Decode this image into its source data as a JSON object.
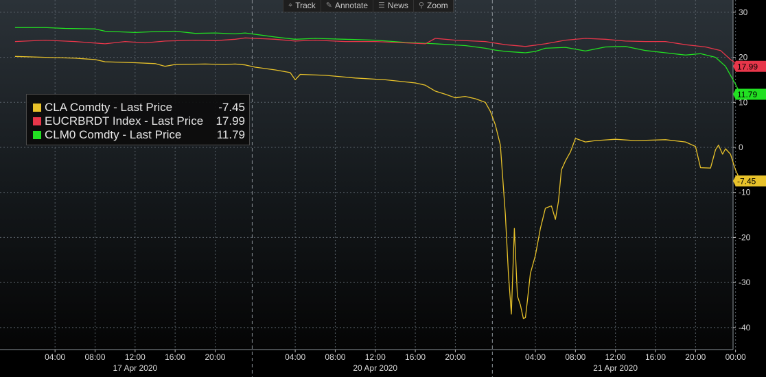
{
  "toolbar": {
    "items": [
      {
        "label": "Track",
        "icon": "crosshair-icon"
      },
      {
        "label": "Annotate",
        "icon": "pencil-icon"
      },
      {
        "label": "News",
        "icon": "news-icon"
      },
      {
        "label": "Zoom",
        "icon": "magnifier-icon"
      }
    ]
  },
  "legend": [
    {
      "name": "CLA Comdty - Last Price",
      "value": "-7.45",
      "color": "#e8c22a"
    },
    {
      "name": "EUCRBRDT Index - Last Price",
      "value": "17.99",
      "color": "#e8364a"
    },
    {
      "name": "CLM0 Comdty - Last Price",
      "value": "11.79",
      "color": "#22e022"
    }
  ],
  "chart_data": {
    "type": "line",
    "title": "",
    "xlabel": "",
    "ylabel": "",
    "x_unit": "hours from 17 Apr 2020 00:00 (compressed session axis)",
    "ylim": [
      -45,
      32
    ],
    "y_ticks": [
      -40,
      -30,
      -20,
      -10,
      0,
      10,
      20,
      30
    ],
    "grid": true,
    "legend_position": "top-left",
    "day_labels": [
      {
        "label": "17 Apr 2020"
      },
      {
        "label": "20 Apr 2020"
      },
      {
        "label": "21 Apr 2020"
      }
    ],
    "x_ticks": [
      {
        "label": "04:00",
        "day": 0,
        "hour": 4
      },
      {
        "label": "08:00",
        "day": 0,
        "hour": 8
      },
      {
        "label": "12:00",
        "day": 0,
        "hour": 12
      },
      {
        "label": "16:00",
        "day": 0,
        "hour": 16
      },
      {
        "label": "20:00",
        "day": 0,
        "hour": 20
      },
      {
        "label": "04:00",
        "day": 1,
        "hour": 4
      },
      {
        "label": "08:00",
        "day": 1,
        "hour": 8
      },
      {
        "label": "12:00",
        "day": 1,
        "hour": 12
      },
      {
        "label": "16:00",
        "day": 1,
        "hour": 16
      },
      {
        "label": "20:00",
        "day": 1,
        "hour": 20
      },
      {
        "label": "04:00",
        "day": 2,
        "hour": 4
      },
      {
        "label": "08:00",
        "day": 2,
        "hour": 8
      },
      {
        "label": "12:00",
        "day": 2,
        "hour": 12
      },
      {
        "label": "16:00",
        "day": 2,
        "hour": 16
      },
      {
        "label": "20:00",
        "day": 2,
        "hour": 20
      },
      {
        "label": "00:00",
        "day": 3,
        "hour": 0
      }
    ],
    "last_values": [
      {
        "label": "17.99",
        "value": 17.99,
        "color": "#e8364a"
      },
      {
        "label": "11.79",
        "value": 11.79,
        "color": "#22e022"
      },
      {
        "label": "-7.45",
        "value": -7.45,
        "color": "#e8c22a"
      }
    ],
    "series": [
      {
        "name": "CLA Comdty - Last Price",
        "color": "#e8c22a",
        "points": [
          [
            0,
            20.2
          ],
          [
            3,
            20.0
          ],
          [
            6,
            19.8
          ],
          [
            8,
            19.5
          ],
          [
            9,
            19.0
          ],
          [
            12,
            18.8
          ],
          [
            14,
            18.6
          ],
          [
            15,
            18.0
          ],
          [
            16,
            18.4
          ],
          [
            19,
            18.5
          ],
          [
            21,
            18.4
          ],
          [
            22,
            18.5
          ],
          [
            23,
            18.3
          ],
          [
            24,
            17.8
          ],
          [
            26,
            17.2
          ],
          [
            27.5,
            16.6
          ],
          [
            28,
            15.0
          ],
          [
            28.5,
            16.2
          ],
          [
            31,
            16.0
          ],
          [
            34,
            15.4
          ],
          [
            37,
            15.0
          ],
          [
            40,
            14.3
          ],
          [
            41,
            13.8
          ],
          [
            42,
            12.5
          ],
          [
            43,
            11.8
          ],
          [
            44,
            11.0
          ],
          [
            45,
            11.3
          ],
          [
            46,
            10.8
          ],
          [
            47,
            10.0
          ],
          [
            47.5,
            8.0
          ],
          [
            48,
            5.0
          ],
          [
            48.5,
            0.5
          ],
          [
            49,
            -15
          ],
          [
            49.3,
            -28
          ],
          [
            49.6,
            -37
          ],
          [
            49.9,
            -18
          ],
          [
            50.2,
            -33
          ],
          [
            50.5,
            -35
          ],
          [
            50.8,
            -38
          ],
          [
            51,
            -37.8
          ],
          [
            51.2,
            -34
          ],
          [
            51.5,
            -28
          ],
          [
            52,
            -24
          ],
          [
            52.5,
            -18
          ],
          [
            53,
            -13.5
          ],
          [
            53.6,
            -13
          ],
          [
            54,
            -16
          ],
          [
            54.3,
            -12
          ],
          [
            54.6,
            -5
          ],
          [
            55,
            -3
          ],
          [
            55.5,
            -1
          ],
          [
            56,
            2.0
          ],
          [
            57,
            1.2
          ],
          [
            58,
            1.5
          ],
          [
            60,
            1.8
          ],
          [
            62,
            1.5
          ],
          [
            65,
            1.7
          ],
          [
            67,
            1.2
          ],
          [
            68,
            0.2
          ],
          [
            68.5,
            -4.5
          ],
          [
            69.5,
            -4.6
          ],
          [
            70,
            -0.5
          ],
          [
            70.3,
            0.5
          ],
          [
            70.7,
            -1.5
          ],
          [
            71,
            -0.3
          ],
          [
            71.5,
            -1.5
          ],
          [
            72,
            -5.0
          ],
          [
            72.5,
            -7.45
          ]
        ]
      },
      {
        "name": "EUCRBRDT Index - Last Price",
        "color": "#e8364a",
        "points": [
          [
            0,
            23.5
          ],
          [
            3,
            23.8
          ],
          [
            6,
            23.5
          ],
          [
            9,
            23.0
          ],
          [
            11,
            23.5
          ],
          [
            13,
            23.2
          ],
          [
            15,
            23.6
          ],
          [
            18,
            23.8
          ],
          [
            20,
            23.7
          ],
          [
            22,
            24.0
          ],
          [
            23,
            24.3
          ],
          [
            26,
            24.0
          ],
          [
            28,
            23.6
          ],
          [
            30,
            23.8
          ],
          [
            33,
            23.5
          ],
          [
            36,
            23.5
          ],
          [
            39,
            23.2
          ],
          [
            41,
            23.0
          ],
          [
            42,
            24.2
          ],
          [
            44,
            23.8
          ],
          [
            47,
            23.5
          ],
          [
            49,
            22.8
          ],
          [
            51,
            22.4
          ],
          [
            53,
            23.0
          ],
          [
            55,
            23.8
          ],
          [
            57,
            24.2
          ],
          [
            59,
            24.0
          ],
          [
            61,
            23.6
          ],
          [
            63,
            23.5
          ],
          [
            65,
            23.5
          ],
          [
            67,
            22.8
          ],
          [
            69,
            22.3
          ],
          [
            70.5,
            21.5
          ],
          [
            71.5,
            19.5
          ],
          [
            72.5,
            17.99
          ]
        ]
      },
      {
        "name": "CLM0 Comdty - Last Price",
        "color": "#22e022",
        "points": [
          [
            0,
            26.6
          ],
          [
            3,
            26.6
          ],
          [
            5,
            26.4
          ],
          [
            8,
            26.3
          ],
          [
            9,
            25.8
          ],
          [
            12,
            25.5
          ],
          [
            14,
            25.7
          ],
          [
            16,
            25.8
          ],
          [
            18,
            25.3
          ],
          [
            20,
            25.4
          ],
          [
            22,
            25.2
          ],
          [
            23,
            25.4
          ],
          [
            26,
            24.5
          ],
          [
            28,
            24.0
          ],
          [
            30,
            24.2
          ],
          [
            33,
            24.0
          ],
          [
            36,
            23.8
          ],
          [
            39,
            23.3
          ],
          [
            42,
            23.0
          ],
          [
            45,
            22.6
          ],
          [
            47,
            22.0
          ],
          [
            48,
            21.6
          ],
          [
            49,
            21.3
          ],
          [
            51,
            21.0
          ],
          [
            52,
            21.3
          ],
          [
            53,
            22.0
          ],
          [
            55,
            22.2
          ],
          [
            57,
            21.4
          ],
          [
            59,
            22.3
          ],
          [
            61,
            22.4
          ],
          [
            63,
            21.5
          ],
          [
            65,
            21.0
          ],
          [
            67,
            20.5
          ],
          [
            68.5,
            20.8
          ],
          [
            70,
            20.0
          ],
          [
            71,
            18.0
          ],
          [
            72,
            14.0
          ],
          [
            72.5,
            11.79
          ]
        ]
      }
    ]
  }
}
